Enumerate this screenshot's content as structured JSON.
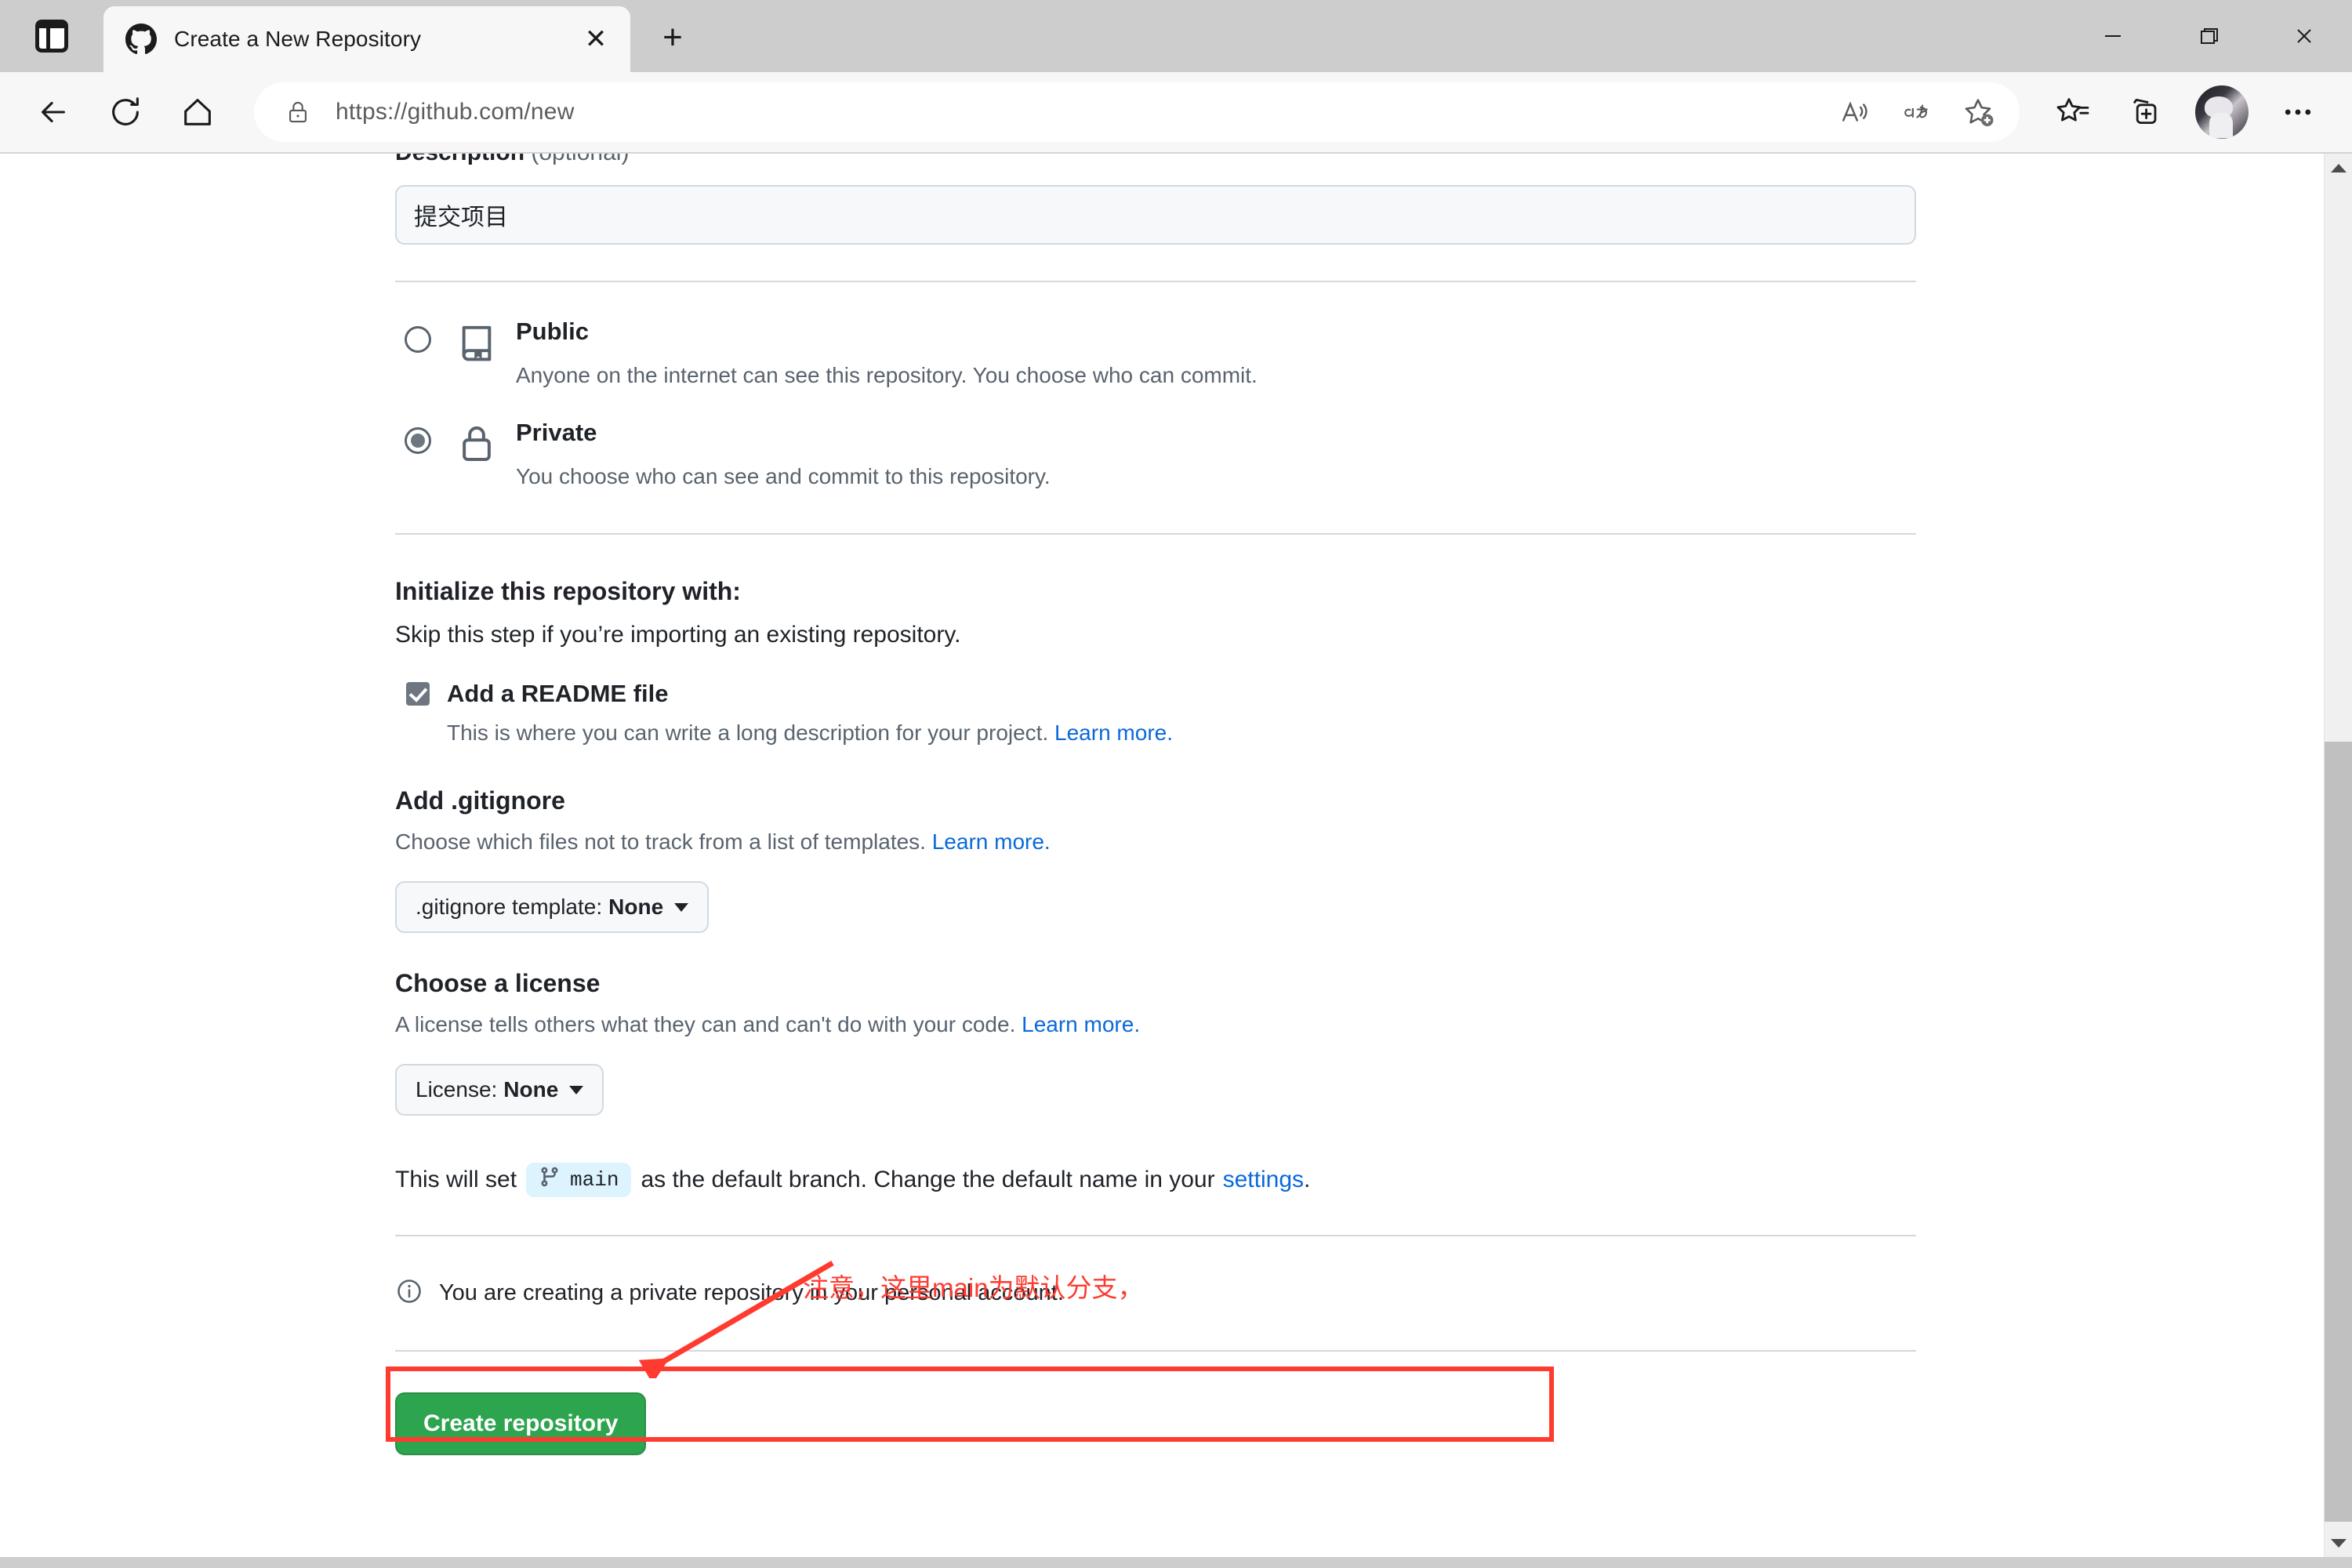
{
  "browser": {
    "tab": {
      "title": "Create a New Repository",
      "favicon": "github-icon",
      "close_label": "✕"
    },
    "new_tab_label": "+",
    "sidebar_toggle": "tab-sidebar-icon",
    "address": {
      "url": "https://github.com/new",
      "lock": "lock-icon"
    },
    "toolbar_actions": [
      {
        "name": "read-aloud-icon",
        "label": "A"
      },
      {
        "name": "translate-icon",
        "label": "aあ"
      },
      {
        "name": "add-favorite-icon",
        "label": "☆"
      },
      {
        "name": "favorites-icon",
        "label": "☆"
      },
      {
        "name": "collections-icon",
        "label": "⧉"
      },
      {
        "name": "profile-avatar",
        "label": ""
      },
      {
        "name": "settings-more-icon",
        "label": "•••"
      }
    ],
    "window_controls": {
      "minimize": "—",
      "restore": "❐",
      "close": "✕"
    }
  },
  "page": {
    "description": {
      "label": "Description",
      "label_optional": " (optional)",
      "value": "提交项目",
      "placeholder": ""
    },
    "visibility": [
      {
        "id": "public",
        "icon": "repo-book-icon",
        "title": "Public",
        "description": "Anyone on the internet can see this repository. You choose who can commit.",
        "selected": false
      },
      {
        "id": "private",
        "icon": "lock-icon",
        "title": "Private",
        "description": "You choose who can see and commit to this repository.",
        "selected": true
      }
    ],
    "initialize": {
      "title": "Initialize this repository with:",
      "subtitle": "Skip this step if you’re importing an existing repository.",
      "readme": {
        "label": "Add a README file",
        "checked": true,
        "description": "This is where you can write a long description for your project. ",
        "link": "Learn more."
      }
    },
    "gitignore": {
      "title": "Add .gitignore",
      "description": "Choose which files not to track from a list of templates. ",
      "link": "Learn more.",
      "dropdown_prefix": ".gitignore template: ",
      "dropdown_value": "None"
    },
    "license": {
      "title": "Choose a license",
      "description": "A license tells others what they can and can't do with your code. ",
      "link": "Learn more.",
      "dropdown_prefix": "License: ",
      "dropdown_value": "None"
    },
    "branch_notice": {
      "prefix": "This will set",
      "branch_icon": "git-branch-icon",
      "branch_name": "main",
      "middle": "as the default branch. Change the default name in your",
      "link": "settings",
      "suffix": "."
    },
    "account_notice": {
      "icon": "info-circle-icon",
      "text": "You are creating a private repository in your personal account."
    },
    "create_button": "Create repository"
  },
  "annotation": {
    "text": "注意，这里main为默认分支，",
    "color": "#ff3b30",
    "arrow": "red-arrow-pointing-to-branch-notice",
    "box": "red-highlight-box"
  },
  "scrollbar": {
    "up_arrow": "scroll-up-arrow-icon",
    "down_arrow": "scroll-down-arrow-icon"
  },
  "colors": {
    "accent_green": "#2da44e",
    "link_blue": "#0969da",
    "annotation_red": "#ff3b30",
    "branch_chip_bg": "#ddf4ff"
  }
}
